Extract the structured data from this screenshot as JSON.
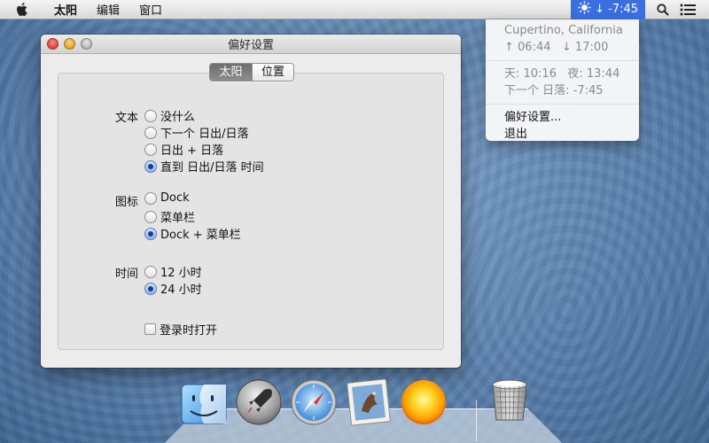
{
  "menubar": {
    "app_name": "太阳",
    "items": [
      "编辑",
      "窗口"
    ],
    "status_text": "↓ -7:45"
  },
  "dropdown": {
    "location": "Cupertino, California",
    "sunrise": "↑ 06:44",
    "sunset": "↓ 17:00",
    "day_length": "天: 10:16",
    "night_length": "夜: 13:44",
    "next_event": "下一个 日落: -7:45",
    "preferences": "偏好设置...",
    "quit": "退出"
  },
  "window": {
    "title": "偏好设置",
    "tabs": [
      "太阳",
      "位置"
    ],
    "active_tab": 0,
    "text_group": {
      "label": "文本",
      "options": [
        "没什么",
        "下一个 日出/日落",
        "日出 + 日落",
        "直到 日出/日落 时间"
      ],
      "selected": 3
    },
    "icon_group": {
      "label": "图标",
      "options": [
        "Dock",
        "菜单栏",
        "Dock + 菜单栏"
      ],
      "selected": 2
    },
    "time_group": {
      "label": "时间",
      "options": [
        "12 小时",
        "24 小时"
      ],
      "selected": 1
    },
    "login_checkbox": {
      "label": "登录时打开",
      "checked": false
    }
  },
  "dock": {
    "apps": [
      "finder-icon",
      "launchpad-icon",
      "safari-icon",
      "mail-icon",
      "sun-app-icon",
      "trash-icon"
    ]
  },
  "colors": {
    "status_highlight": "#3b6fe0",
    "desktop": "#5b82ae",
    "radio_selected": "#1b3e8a"
  }
}
